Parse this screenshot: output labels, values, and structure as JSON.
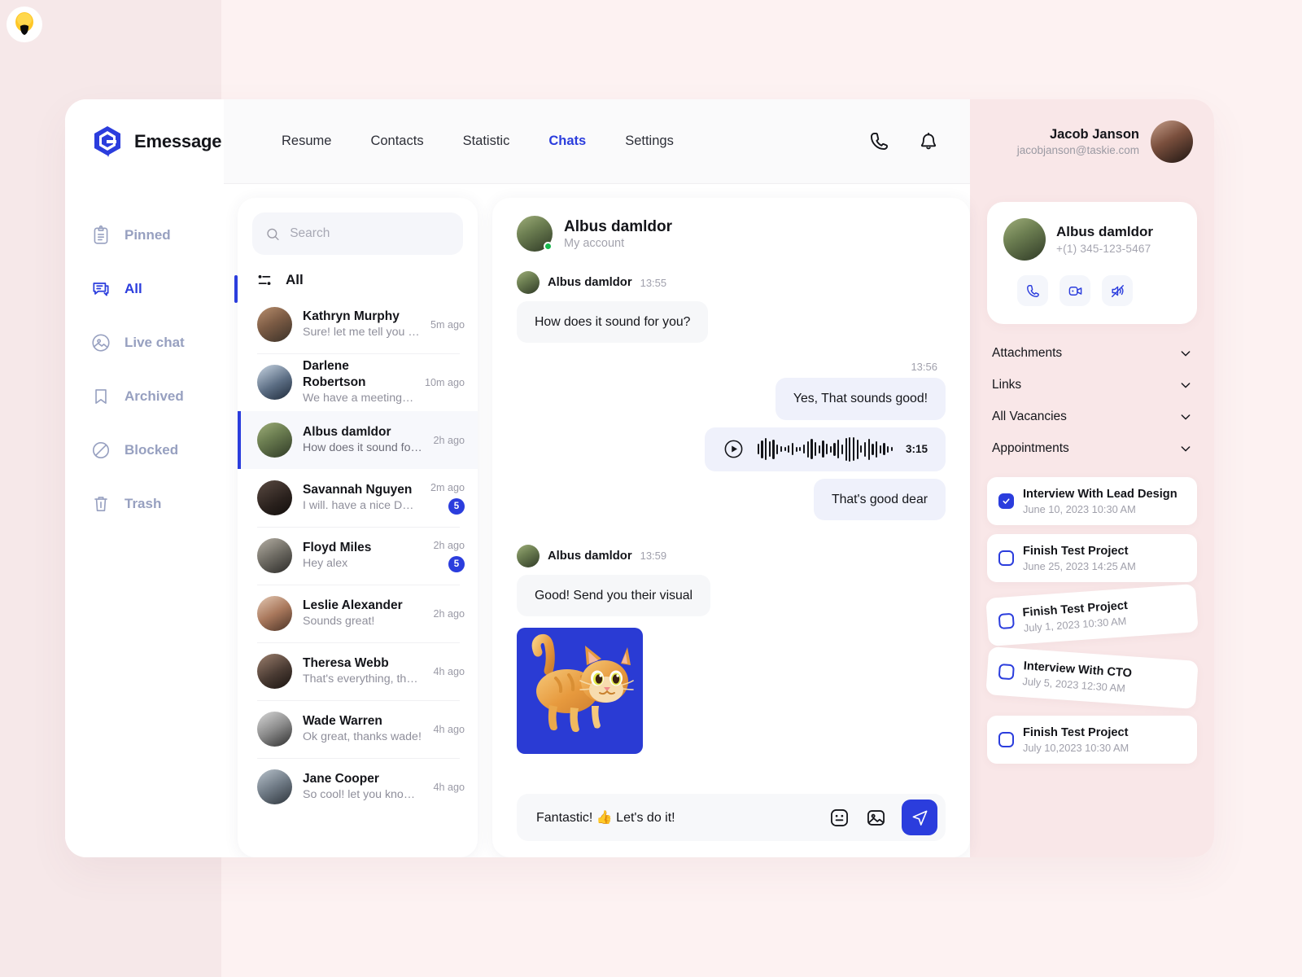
{
  "accent": "#2b3ddd",
  "bg": {
    "left": "#f6e8e9",
    "right": "#fdf2f2",
    "panel": "#f9e7e8"
  },
  "brand": {
    "name": "Emessage",
    "logo_icon": "emessage-logo-icon"
  },
  "topnav": {
    "items": [
      {
        "label": "Resume",
        "active": false
      },
      {
        "label": "Contacts",
        "active": false
      },
      {
        "label": "Statistic",
        "active": false
      },
      {
        "label": "Chats",
        "active": true
      },
      {
        "label": "Settings",
        "active": false
      }
    ],
    "call_icon": "phone-icon",
    "notification_icon": "bell-icon"
  },
  "account": {
    "name": "Jacob Janson",
    "email": "jacobjanson@taskie.com"
  },
  "sidebar": {
    "items": [
      {
        "label": "Pinned",
        "icon": "pinned-clipboard-icon",
        "active": false
      },
      {
        "label": "All",
        "icon": "chat-bubbles-icon",
        "active": true
      },
      {
        "label": "Live chat",
        "icon": "live-chat-image-icon",
        "active": false
      },
      {
        "label": "Archived",
        "icon": "bookmark-icon",
        "active": false
      },
      {
        "label": "Blocked",
        "icon": "blocked-circle-icon",
        "active": false
      },
      {
        "label": "Trash",
        "icon": "trash-icon",
        "active": false
      }
    ]
  },
  "search": {
    "placeholder": "Search",
    "value": "",
    "icon": "search-icon"
  },
  "filter": {
    "label": "All",
    "icon": "filter-sliders-icon"
  },
  "chats": [
    {
      "name": "Kathryn Murphy",
      "preview": "Sure! let me tell you about wh..",
      "time": "5m ago",
      "unread": "",
      "selected": false,
      "av": "av1"
    },
    {
      "name": "Darlene Robertson",
      "preview": "We have a meeting with saj",
      "time": "10m ago",
      "unread": "",
      "selected": false,
      "av": "av2"
    },
    {
      "name": "Albus damldor",
      "preview": "How does it sound for you?",
      "time": "2h ago",
      "unread": "",
      "selected": true,
      "av": "av3"
    },
    {
      "name": "Savannah Nguyen",
      "preview": "I will. have a nice Day?",
      "time": "2m ago",
      "unread": "5",
      "selected": false,
      "av": "av4"
    },
    {
      "name": "Floyd Miles",
      "preview": "Hey alex",
      "time": "2h ago",
      "unread": "5",
      "selected": false,
      "av": "av5"
    },
    {
      "name": "Leslie Alexander",
      "preview": "Sounds great!",
      "time": "2h ago",
      "unread": "",
      "selected": false,
      "av": "av6"
    },
    {
      "name": "Theresa Webb",
      "preview": "That's everything, thanks again!",
      "time": "4h ago",
      "unread": "",
      "selected": false,
      "av": "av7"
    },
    {
      "name": "Wade Warren",
      "preview": "Ok great, thanks wade!",
      "time": "4h ago",
      "unread": "",
      "selected": false,
      "av": "av8"
    },
    {
      "name": "Jane Cooper",
      "preview": "So cool! let you know if...",
      "time": "4h ago",
      "unread": "",
      "selected": false,
      "av": "av9"
    }
  ],
  "conversation": {
    "title": "Albus damldor",
    "subtitle": "My account",
    "online": true,
    "groups": [
      {
        "sender": "Albus damldor",
        "time": "13:55"
      },
      {
        "sender": "Albus damldor",
        "time": "13:59"
      }
    ],
    "msg_in_1": "How does it sound for you?",
    "out_time": "13:56",
    "msg_out_1": "Yes, That sounds good!",
    "voice": {
      "duration": "3:15",
      "play_icon": "play-circle-icon"
    },
    "msg_out_2": "That's good dear",
    "msg_in_2": "Good! Send you their visual",
    "attachment": {
      "type": "image",
      "alt": "orange cat illustration on blue background"
    }
  },
  "composer": {
    "value": "Fantastic! 👍 Let's do it!",
    "emoji_icon": "emoji-icon",
    "image_icon": "image-icon",
    "send_icon": "send-icon"
  },
  "contact_card": {
    "name": "Albus damldor",
    "phone": "+(1) 345-123-5467",
    "actions": [
      {
        "icon": "phone-icon",
        "name": "call-button"
      },
      {
        "icon": "video-icon",
        "name": "video-call-button"
      },
      {
        "icon": "mute-sound-icon",
        "name": "mute-button"
      }
    ]
  },
  "accordions": [
    {
      "label": "Attachments",
      "icon": "chevron-down-icon"
    },
    {
      "label": "Links",
      "icon": "chevron-down-icon"
    },
    {
      "label": "All Vacancies",
      "icon": "chevron-down-icon"
    },
    {
      "label": "Appointments",
      "icon": "chevron-down-icon"
    }
  ],
  "tasks": [
    {
      "title": "Interview With Lead Design",
      "date": "June 10, 2023 10:30 AM",
      "done": true,
      "tilt": 0
    },
    {
      "title": "Finish Test Project",
      "date": "June 25, 2023 14:25 AM",
      "done": false,
      "tilt": 0
    },
    {
      "title": "Finish Test Project",
      "date": "July 1, 2023 10:30 AM",
      "done": false,
      "tilt": -4
    },
    {
      "title": "Interview With CTO",
      "date": "July 5, 2023 12:30 AM",
      "done": false,
      "tilt": 4
    },
    {
      "title": "Finish Test Project",
      "date": "July 10,2023 10:30 AM",
      "done": false,
      "tilt": 0
    }
  ]
}
